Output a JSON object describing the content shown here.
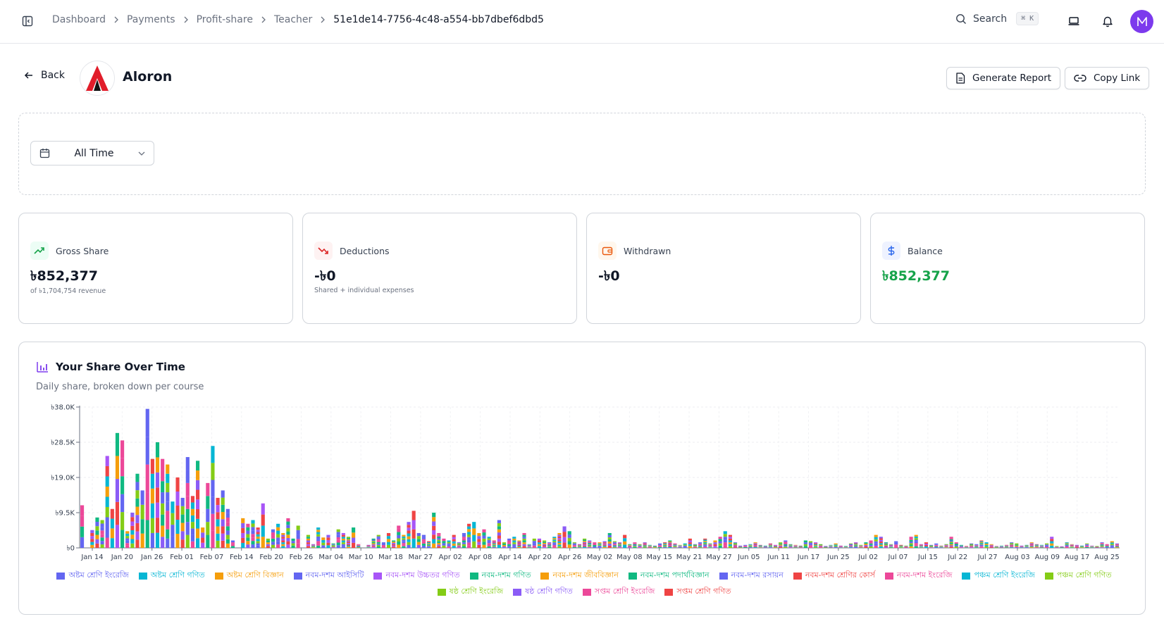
{
  "breadcrumb": [
    "Dashboard",
    "Payments",
    "Profit-share",
    "Teacher",
    "51e1de14-7756-4c48-a554-bb7dbef6dbd5"
  ],
  "search": {
    "label": "Search",
    "shortcut": "⌘ K"
  },
  "header": {
    "back_label": "Back",
    "title": "Aloron",
    "generate_label": "Generate Report",
    "copy_label": "Copy Link"
  },
  "filter": {
    "date_range": "All Time"
  },
  "stats": [
    {
      "label": "Gross Share",
      "value": "৳852,377",
      "sub": "of ৳1,704,754 revenue",
      "icon": "trending-up-icon",
      "color": "#16a34a"
    },
    {
      "label": "Deductions",
      "value": "-৳0",
      "sub": "Shared + individual expenses",
      "icon": "trending-down-icon",
      "color": "#dc2626"
    },
    {
      "label": "Withdrawn",
      "value": "-৳0",
      "sub": "",
      "icon": "wallet-icon",
      "color": "#ea580c"
    },
    {
      "label": "Balance",
      "value": "৳852,377",
      "sub": "",
      "icon": "dollar-icon",
      "color": "#16a34a"
    }
  ],
  "colors": {
    "accent": "#7c3aed",
    "positive": "#16a34a",
    "negative": "#dc2626"
  },
  "chart_data": {
    "type": "bar",
    "stacked": true,
    "title": "Your Share Over Time",
    "subtitle": "Daily share, broken down per course",
    "ylim": [
      0,
      38000
    ],
    "y_ticks": [
      "৳0",
      "৳9.5K",
      "৳19.0K",
      "৳28.5K",
      "৳38.0K"
    ],
    "x_ticks": [
      "Jan 14",
      "Jan 20",
      "Jan 26",
      "Feb 01",
      "Feb 07",
      "Feb 14",
      "Feb 20",
      "Feb 26",
      "Mar 04",
      "Mar 10",
      "Mar 18",
      "Mar 27",
      "Apr 02",
      "Apr 08",
      "Apr 14",
      "Apr 20",
      "Apr 26",
      "May 02",
      "May 08",
      "May 15",
      "May 21",
      "May 27",
      "Jun 05",
      "Jun 11",
      "Jun 17",
      "Jun 25",
      "Jul 02",
      "Jul 07",
      "Jul 15",
      "Jul 22",
      "Jul 27",
      "Aug 03",
      "Aug 09",
      "Aug 17",
      "Aug 25"
    ],
    "grid": true,
    "legend": "bottom",
    "series": [
      {
        "name": "অষ্টম শ্রেণি ইংরেজি",
        "color": "#6366f1"
      },
      {
        "name": "অষ্টম শ্রেণি গণিত",
        "color": "#06b6d4"
      },
      {
        "name": "অষ্টম শ্রেণি বিজ্ঞান",
        "color": "#f59e0b"
      },
      {
        "name": "নবম-দশম আইসিটি",
        "color": "#6366f1"
      },
      {
        "name": "নবম-দশম উচ্চতর গণিত",
        "color": "#a855f7"
      },
      {
        "name": "নবম-দশম গণিত",
        "color": "#10b981"
      },
      {
        "name": "নবম-দশম জীববিজ্ঞান",
        "color": "#f59e0b"
      },
      {
        "name": "নবম-দশম পদার্থবিজ্ঞান",
        "color": "#10b981"
      },
      {
        "name": "নবম-দশম রসায়ন",
        "color": "#6366f1"
      },
      {
        "name": "নবম-দশম শ্রেণির কোর্স",
        "color": "#ef4444"
      },
      {
        "name": "নবম-দশম ইংরেজি",
        "color": "#ec4899"
      },
      {
        "name": "পঞ্চম শ্রেণি ইংরেজি",
        "color": "#06b6d4"
      },
      {
        "name": "পঞ্চম শ্রেণি গণিত",
        "color": "#84cc16"
      },
      {
        "name": "ষষ্ঠ শ্রেণি ইংরেজি",
        "color": "#84cc16"
      },
      {
        "name": "ষষ্ঠ শ্রেণি গণিত",
        "color": "#8b5cf6"
      },
      {
        "name": "সপ্তম শ্রেণি ইংরেজি",
        "color": "#ec4899"
      },
      {
        "name": "সপ্তম শ্রেণি গণিত",
        "color": "#ef4444"
      }
    ],
    "daily_totals": [
      11500,
      0,
      4800,
      8200,
      7500,
      24800,
      10500,
      31000,
      29000,
      4500,
      9500,
      20000,
      15500,
      37500,
      24000,
      28500,
      24000,
      22500,
      12500,
      19000,
      13500,
      24500,
      14000,
      23500,
      5500,
      17500,
      27500,
      13500,
      15500,
      10500,
      2000,
      0,
      8000,
      6500,
      7500,
      5500,
      12000,
      2500,
      5000,
      6500,
      4000,
      8000,
      2500,
      6000,
      0,
      3500,
      1000,
      5500,
      2800,
      3500,
      1200,
      5000,
      4000,
      3000,
      5500,
      1000,
      0,
      800,
      2500,
      3500,
      1500,
      4000,
      2000,
      6000,
      3500,
      7000,
      10000,
      4000,
      3500,
      1800,
      9500,
      4000,
      2500,
      2000,
      3500,
      1500,
      4000,
      6500,
      7000,
      4000,
      5000,
      3000,
      2000,
      7500,
      1500,
      2500,
      3000,
      2000,
      4000,
      1000,
      2500,
      2500,
      2000,
      1500,
      3000,
      4000,
      5800,
      4500,
      1500,
      1000,
      2500,
      2000,
      1500,
      1500,
      1800,
      4000,
      1800,
      1500,
      3500,
      1000,
      1500,
      1000,
      1500,
      800,
      600,
      1200,
      1500,
      2000,
      1200,
      800,
      1200,
      2500,
      1000,
      1500,
      2500,
      1200,
      2000,
      3000,
      4500,
      3500,
      1500,
      600,
      800,
      1000,
      1500,
      800,
      600,
      1200,
      800,
      1500,
      2000,
      1000,
      800,
      600,
      2000,
      1800,
      1500,
      1000,
      500,
      800,
      1200,
      600,
      500,
      1200,
      1500,
      800,
      1500,
      2000,
      3500,
      3000,
      1500,
      1000,
      1800,
      800,
      600,
      3000,
      3500,
      1000,
      1500,
      800,
      1200,
      600,
      1000,
      3000,
      1500,
      800,
      500,
      1200,
      1000,
      2000,
      1500,
      1000,
      500,
      600,
      800,
      1500,
      1200,
      600,
      800,
      1500,
      1000,
      800,
      1200,
      3000,
      500,
      400,
      1500,
      1000,
      800,
      600,
      1200,
      600,
      500,
      1500,
      1000,
      1800,
      1200
    ]
  }
}
